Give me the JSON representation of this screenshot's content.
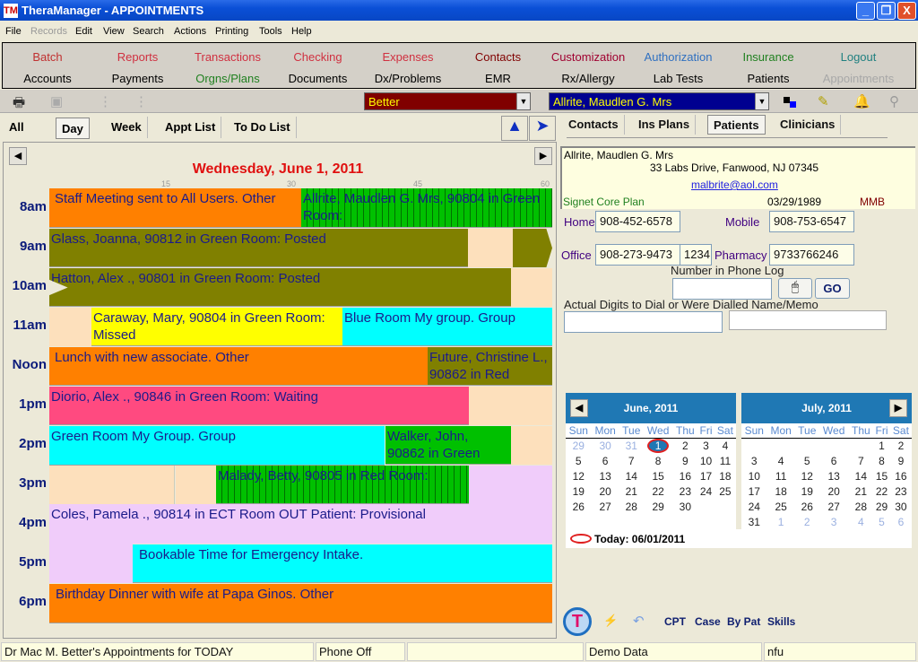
{
  "window": {
    "title": "TheraManager - APPOINTMENTS",
    "logo": "TM",
    "minimize": "_",
    "restore": "❐",
    "close": "X"
  },
  "menu": [
    "File",
    "Records",
    "Edit",
    "View",
    "Search",
    "Actions",
    "Printing",
    "Tools",
    "Help"
  ],
  "nav_row1": [
    {
      "label": "Batch",
      "color": "#c03030"
    },
    {
      "label": "Reports",
      "color": "#d03040"
    },
    {
      "label": "Transactions",
      "color": "#d03040"
    },
    {
      "label": "Checking",
      "color": "#d03040"
    },
    {
      "label": "Expenses",
      "color": "#d03040"
    },
    {
      "label": "Contacts",
      "color": "#800000"
    },
    {
      "label": "Customization",
      "color": "#a00030"
    },
    {
      "label": "Authorization",
      "color": "#3070c0"
    },
    {
      "label": "Insurance",
      "color": "#208020"
    },
    {
      "label": "Logout",
      "color": "#208080"
    }
  ],
  "nav_row2": [
    {
      "label": "Accounts",
      "color": "#000"
    },
    {
      "label": "Payments",
      "color": "#000"
    },
    {
      "label": "Orgns/Plans",
      "color": "#208020"
    },
    {
      "label": "Documents",
      "color": "#000"
    },
    {
      "label": "Dx/Problems",
      "color": "#000"
    },
    {
      "label": "EMR",
      "color": "#000"
    },
    {
      "label": "Rx/Allergy",
      "color": "#000"
    },
    {
      "label": "Lab Tests",
      "color": "#000"
    },
    {
      "label": "Patients",
      "color": "#000"
    },
    {
      "label": "Appointments",
      "color": "#a8a8a8"
    }
  ],
  "toolbar": {
    "provider": "Better",
    "patient": "Allrite, Maudlen G. Mrs"
  },
  "view_tabs": [
    "All",
    "Day",
    "Week",
    "Appt List",
    "To Do List"
  ],
  "right_tabs": [
    "Contacts",
    "Ins Plans",
    "Patients",
    "Clinicians"
  ],
  "schedule": {
    "date": "Wednesday, June 1, 2011",
    "minute_ticks": [
      "15",
      "30",
      "45",
      "60"
    ],
    "hours": [
      "8am",
      "9am",
      "10am",
      "11am",
      "Noon",
      "1pm",
      "2pm",
      "3pm",
      "4pm",
      "5pm",
      "6pm"
    ],
    "appointments": [
      {
        "text": "Staff Meeting sent to All Users. Other",
        "color": "#ff8000"
      },
      {
        "text": "Allrite, Maudlen G. Mrs, 90804 in Green Room:",
        "color": "#00c000"
      },
      {
        "text": "Glass, Joanna, 90812 in Green Room: Posted",
        "color": "#808000"
      },
      {
        "text": "Hatton, Alex ., 90801 in Green Room: Posted",
        "color": "#808000"
      },
      {
        "text": "Caraway, Mary, 90804 in Green Room: Missed",
        "color": "#ffff00"
      },
      {
        "text": "Blue Room My group. Group",
        "color": "#00ffff"
      },
      {
        "text": "Lunch with new associate. Other",
        "color": "#ff8000"
      },
      {
        "text": "Future, Christine L., 90862 in Red",
        "color": "#808000"
      },
      {
        "text": "Diorio, Alex ., 90846 in Green Room: Waiting",
        "color": "#ff4a80"
      },
      {
        "text": "Green Room My Group. Group",
        "color": "#00ffff"
      },
      {
        "text": "Walker, John, 90862 in Green",
        "color": "#00c000"
      },
      {
        "text": "Malady, Betty, 90805 in Red Room:",
        "color": "#00c000"
      },
      {
        "text": "Coles, Pamela ., 90814 in ECT Room OUT Patient: Provisional",
        "color": "#f0ccfa"
      },
      {
        "text": "Bookable Time for Emergency Intake.",
        "color": "#00ffff"
      },
      {
        "text": "Birthday Dinner with wife at Papa Ginos. Other",
        "color": "#ff8000"
      }
    ]
  },
  "patient": {
    "name": "Allrite, Maudlen G. Mrs",
    "address": "33 Labs Drive, Fanwood, NJ 07345",
    "email": "malbrite@aol.com",
    "plan": "Signet Core Plan",
    "dob": "03/29/1989",
    "code": "MMB",
    "home_label": "Home",
    "home": "908-452-6578",
    "mobile_label": "Mobile",
    "mobile": "908-753-6547",
    "office_label": "Office",
    "office": "908-273-9473",
    "ext": "1234",
    "pharmacy_label": "Pharmacy",
    "pharmacy": "9733766246",
    "phone_log_label": "Number in Phone Log",
    "phone_log": "",
    "go": "GO",
    "dial_label": "Actual Digits to Dial or Were Dialled Name/Memo",
    "dial": "",
    "memo": ""
  },
  "calendars": [
    {
      "title": "June, 2011",
      "weekdays": [
        "Sun",
        "Mon",
        "Tue",
        "Wed",
        "Thu",
        "Fri",
        "Sat"
      ],
      "weeks": [
        [
          {
            "d": "29",
            "other": true
          },
          {
            "d": "30",
            "other": true
          },
          {
            "d": "31",
            "other": true
          },
          {
            "d": "1",
            "today": true
          },
          {
            "d": "2"
          },
          {
            "d": "3"
          },
          {
            "d": "4"
          }
        ],
        [
          {
            "d": "5"
          },
          {
            "d": "6"
          },
          {
            "d": "7"
          },
          {
            "d": "8"
          },
          {
            "d": "9"
          },
          {
            "d": "10"
          },
          {
            "d": "11"
          }
        ],
        [
          {
            "d": "12"
          },
          {
            "d": "13"
          },
          {
            "d": "14"
          },
          {
            "d": "15"
          },
          {
            "d": "16"
          },
          {
            "d": "17"
          },
          {
            "d": "18"
          }
        ],
        [
          {
            "d": "19"
          },
          {
            "d": "20"
          },
          {
            "d": "21"
          },
          {
            "d": "22"
          },
          {
            "d": "23"
          },
          {
            "d": "24"
          },
          {
            "d": "25"
          }
        ],
        [
          {
            "d": "26"
          },
          {
            "d": "27"
          },
          {
            "d": "28"
          },
          {
            "d": "29"
          },
          {
            "d": "30"
          },
          {
            "d": ""
          },
          {
            "d": ""
          }
        ]
      ]
    },
    {
      "title": "July, 2011",
      "weekdays": [
        "Sun",
        "Mon",
        "Tue",
        "Wed",
        "Thu",
        "Fri",
        "Sat"
      ],
      "weeks": [
        [
          {
            "d": ""
          },
          {
            "d": ""
          },
          {
            "d": ""
          },
          {
            "d": ""
          },
          {
            "d": ""
          },
          {
            "d": "1"
          },
          {
            "d": "2"
          }
        ],
        [
          {
            "d": "3"
          },
          {
            "d": "4"
          },
          {
            "d": "5"
          },
          {
            "d": "6"
          },
          {
            "d": "7"
          },
          {
            "d": "8"
          },
          {
            "d": "9"
          }
        ],
        [
          {
            "d": "10"
          },
          {
            "d": "11"
          },
          {
            "d": "12"
          },
          {
            "d": "13"
          },
          {
            "d": "14"
          },
          {
            "d": "15"
          },
          {
            "d": "16"
          }
        ],
        [
          {
            "d": "17"
          },
          {
            "d": "18"
          },
          {
            "d": "19"
          },
          {
            "d": "20"
          },
          {
            "d": "21"
          },
          {
            "d": "22"
          },
          {
            "d": "23"
          }
        ],
        [
          {
            "d": "24"
          },
          {
            "d": "25"
          },
          {
            "d": "26"
          },
          {
            "d": "27"
          },
          {
            "d": "28"
          },
          {
            "d": "29"
          },
          {
            "d": "30"
          }
        ],
        [
          {
            "d": "31"
          },
          {
            "d": "1",
            "other": true
          },
          {
            "d": "2",
            "other": true
          },
          {
            "d": "3",
            "other": true
          },
          {
            "d": "4",
            "other": true
          },
          {
            "d": "5",
            "other": true
          },
          {
            "d": "6",
            "other": true
          }
        ]
      ]
    }
  ],
  "today_label": "Today: 06/01/2011",
  "bottom_links": [
    "CPT",
    "Case",
    "By Pat",
    "Skills"
  ],
  "status": [
    "Dr Mac M. Better's Appointments  for TODAY",
    "Phone Off",
    "",
    "Demo Data",
    "nfu"
  ]
}
